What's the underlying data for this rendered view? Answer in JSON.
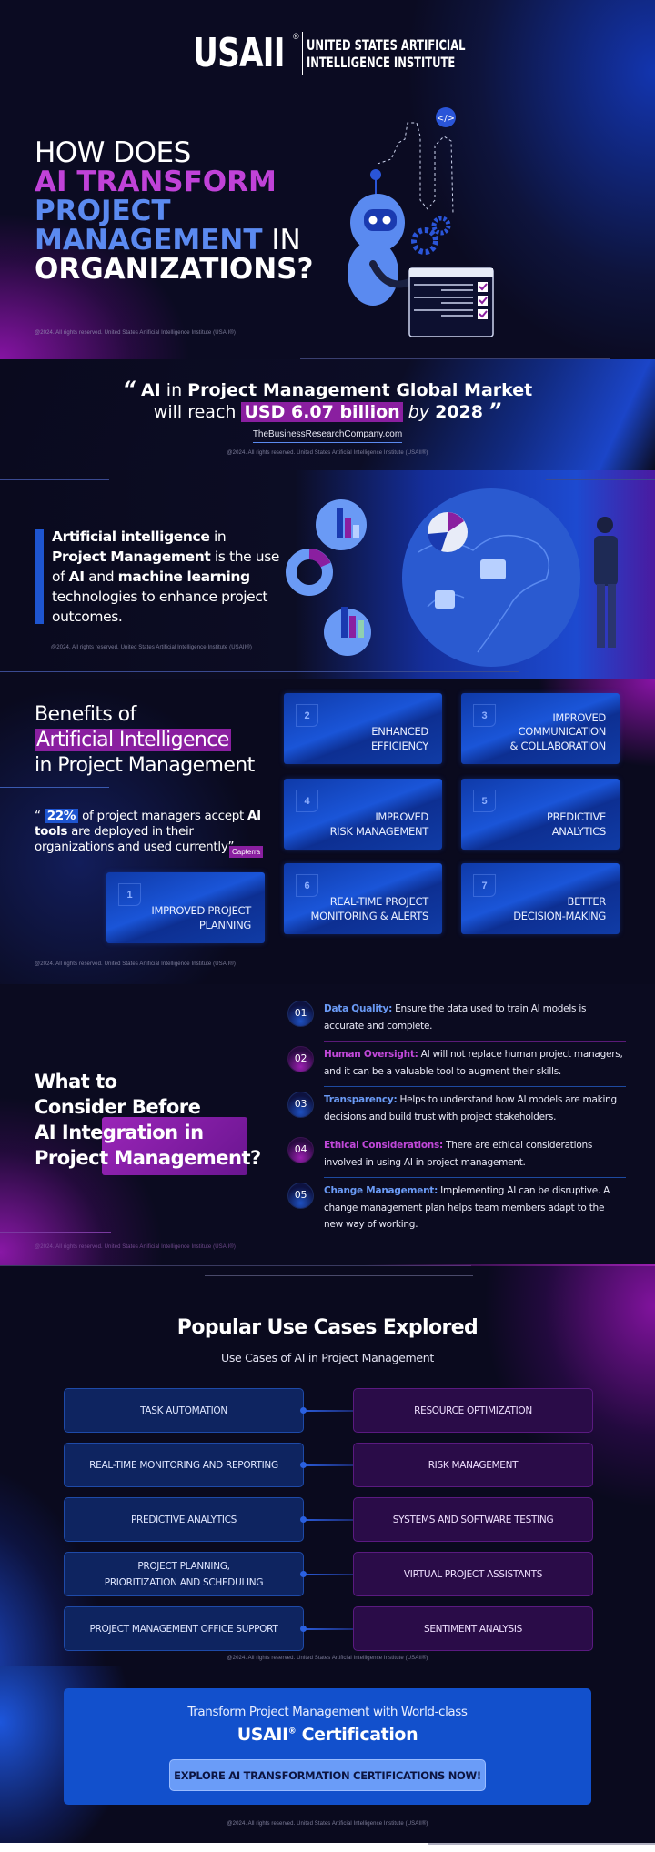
{
  "brand": {
    "logo_mark": "USAII",
    "registered": "®",
    "logo_line1": "UNITED STATES ARTIFICIAL",
    "logo_line2": "INTELLIGENCE INSTITUTE"
  },
  "colors": {
    "accent_purple": "#8a1fa0",
    "accent_blue": "#1e55d0",
    "title_purple": "#c042d8",
    "title_blue": "#5b8af0",
    "background": "#0a0a1e"
  },
  "copyright": "@2024. All rights reserved. United States Artificial Intelligence Institute (USAII®)",
  "hero": {
    "line1": "HOW DOES",
    "line2": "AI TRANSFORM",
    "line3": "PROJECT",
    "line4_bold": "MANAGEMENT",
    "line4_rest": " IN",
    "line5": "ORGANIZATIONS?",
    "illustration": "robot-and-person-with-task-checklist"
  },
  "market": {
    "open_quote": "“",
    "part1": "AI",
    "part2": " in ",
    "part3": "Project Management Global Market",
    "part4": "will reach ",
    "highlight": "USD 6.07 billion",
    "part5": " by ",
    "year": "2028",
    "close_quote": "”",
    "source": "TheBusinessResearchCompany.com"
  },
  "definition": {
    "b1": "Artificial intelligence",
    "t1": " in ",
    "b2": "Project Management",
    "t2": " is the use of ",
    "b3": "AI",
    "t3": " and ",
    "b4": "machine learning",
    "t4": " technologies to enhance project outcomes.",
    "illustration": "globe-with-charts-and-person"
  },
  "benefits": {
    "title_line1": "Benefits of",
    "title_highlight": "Artificial Intelligence",
    "title_line3": "in Project Management",
    "stat_open": "“ ",
    "stat_pct": "22%",
    "stat_t1": "  of project managers accept ",
    "stat_b1": "AI tools",
    "stat_t2": " are deployed in their organizations and used currently”",
    "stat_source": "Capterra",
    "cards": [
      {
        "num": "1",
        "label": "IMPROVED PROJECT\nPLANNING"
      },
      {
        "num": "2",
        "label": "ENHANCED\nEFFICIENCY"
      },
      {
        "num": "3",
        "label": "IMPROVED\nCOMMUNICATION\n& COLLABORATION"
      },
      {
        "num": "4",
        "label": "IMPROVED\nRISK MANAGEMENT"
      },
      {
        "num": "5",
        "label": "PREDICTIVE\nANALYTICS"
      },
      {
        "num": "6",
        "label": "REAL-TIME PROJECT\nMONITORING & ALERTS"
      },
      {
        "num": "7",
        "label": "BETTER\nDECISION-MAKING"
      }
    ]
  },
  "consider": {
    "title_l1": "What to",
    "title_l2": "Consider Before",
    "title_l3": "AI Integration in",
    "title_l4": "Project Management?",
    "items": [
      {
        "num": "01",
        "key": "Data Quality:",
        "text": " Ensure the data used to train AI models is accurate and complete."
      },
      {
        "num": "02",
        "key": "Human Oversight:",
        "text": " AI will not replace human project managers, and it can be a valuable tool to augment their skills."
      },
      {
        "num": "03",
        "key": "Transparency:",
        "text": " Helps to understand how AI models are making decisions and build trust with project stakeholders."
      },
      {
        "num": "04",
        "key": "Ethical Considerations:",
        "text": " There are ethical considerations involved in using AI in project management."
      },
      {
        "num": "05",
        "key": "Change Management:",
        "text": " Implementing AI can be disruptive. A change management plan helps team members adapt to the new way of working."
      }
    ]
  },
  "usecases": {
    "title": "Popular Use Cases Explored",
    "subtitle": "Use Cases of AI in Project Management",
    "rows": [
      {
        "left": "TASK AUTOMATION",
        "right": "RESOURCE OPTIMIZATION"
      },
      {
        "left": "REAL-TIME MONITORING AND REPORTING",
        "right": "RISK MANAGEMENT"
      },
      {
        "left": "PREDICTIVE ANALYTICS",
        "right": "SYSTEMS AND SOFTWARE TESTING"
      },
      {
        "left": "PROJECT PLANNING,\nPRIORITIZATION AND SCHEDULING",
        "right": "VIRTUAL PROJECT ASSISTANTS"
      },
      {
        "left": "PROJECT MANAGEMENT OFFICE SUPPORT",
        "right": "SENTIMENT ANALYSIS"
      }
    ]
  },
  "cta": {
    "line1": "Transform Project Management with World-class",
    "brand": "USAII",
    "reg": "®",
    "line2_rest": " Certification",
    "button": "EXPLORE AI TRANSFORMATION CERTIFICATIONS NOW!"
  }
}
